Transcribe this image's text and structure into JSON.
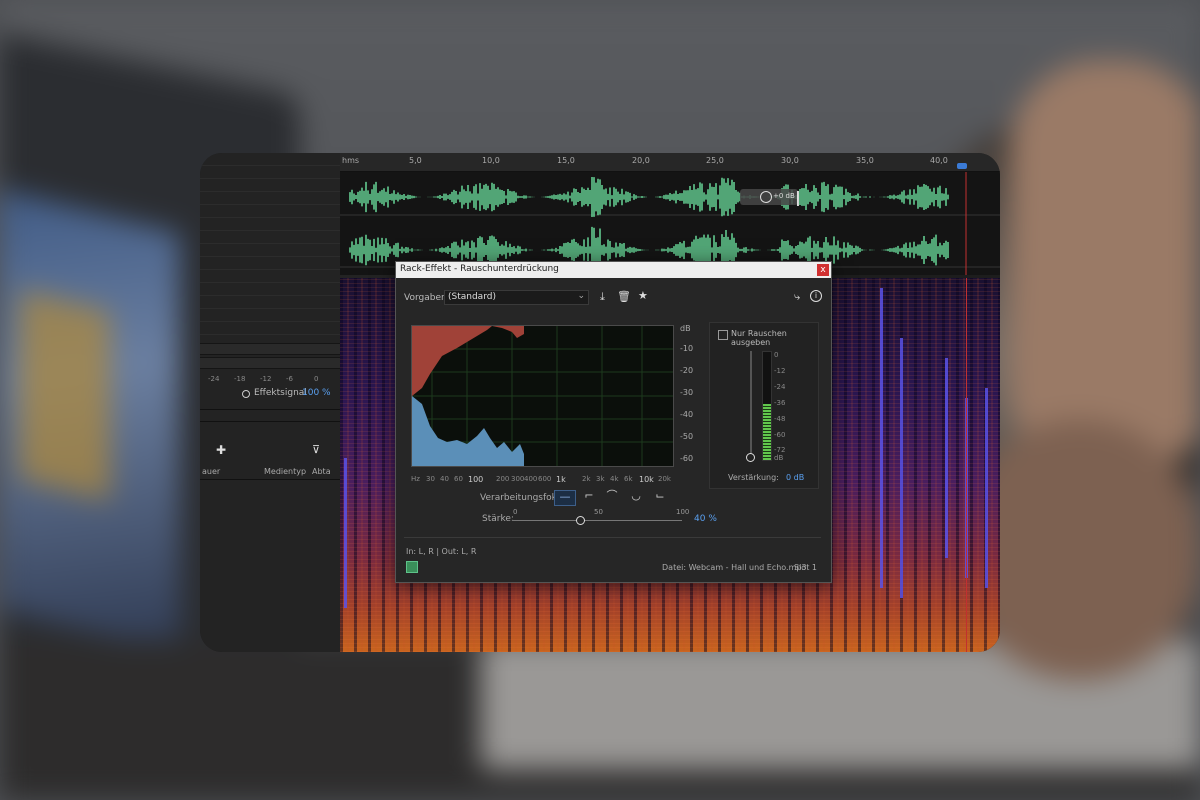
{
  "app": {
    "left_panel": {
      "effekt_label": "Effektsignal",
      "effekt_value": "100 %",
      "db_ticks": [
        "-24",
        "-18",
        "-12",
        "-6",
        "0"
      ],
      "media_columns": [
        "auer",
        "Medientyp",
        "Abta"
      ]
    },
    "timeline": {
      "unit": "hms",
      "ticks": [
        "5,0",
        "10,0",
        "15,0",
        "20,0",
        "25,0",
        "30,0",
        "35,0",
        "40,0"
      ]
    },
    "hud": {
      "value": "+0 dB"
    }
  },
  "dialog": {
    "title": "Rack-Effekt - Rauschunterdrückung",
    "close": "x",
    "preset_label": "Vorgaben:",
    "preset_value": "(Standard)",
    "graph": {
      "db_label": "dB",
      "db_ticks": [
        "-10",
        "-20",
        "-30",
        "-40",
        "-50",
        "-60"
      ],
      "hz_label": "Hz",
      "hz_ticks": [
        "30",
        "40",
        "60",
        "100",
        "200",
        "300",
        "400",
        "600",
        "1k",
        "2k",
        "3k",
        "4k",
        "6k",
        "10k",
        "20k"
      ]
    },
    "fokus_label": "Verarbeitungsfokus:",
    "staerke": {
      "label": "Stärke:",
      "ticks": [
        "0",
        "50",
        "100"
      ],
      "value": "40 %",
      "level_percent": 40
    },
    "noise_only_label": "Nur Rauschen ausgeben",
    "meter": {
      "ticks": [
        "0",
        "-12",
        "-24",
        "-36",
        "-48",
        "-60",
        "-72"
      ],
      "unit": "dB",
      "level_percent": 52
    },
    "gain_label": "Verstärkung:",
    "gain_value": "0 dB",
    "io": "In: L, R | Out: L, R",
    "file": "Datei: Webcam - Hall und Echo.mp3",
    "slot": "Slot 1"
  },
  "colors": {
    "waveform": "#6de3a0",
    "accent_blue": "#5aa0f0",
    "noise_red": "#a04238",
    "signal_blue": "#5b8fb8",
    "meter_green": "#61c74d"
  }
}
